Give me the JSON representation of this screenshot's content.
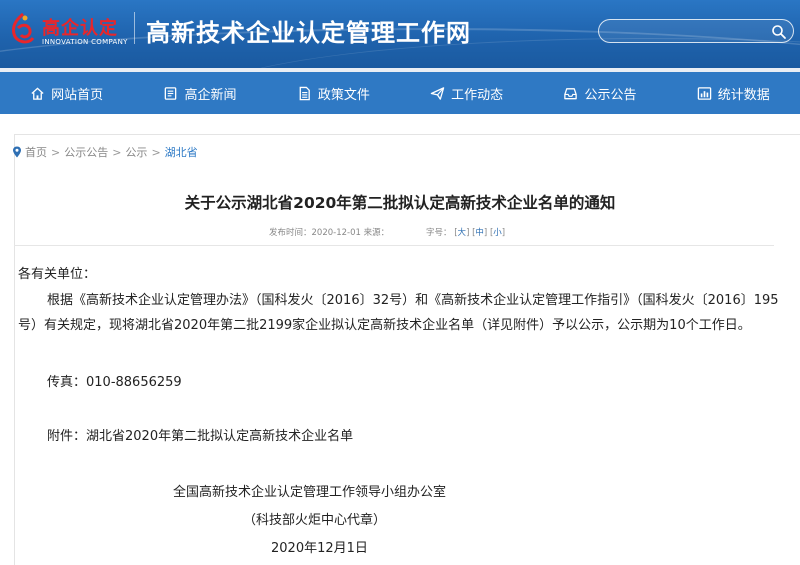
{
  "header": {
    "logo_cn": "高企认定",
    "logo_en": "INNOVATION COMPANY",
    "site_title": "高新技术企业认定管理工作网",
    "search": {
      "value": "",
      "placeholder": ""
    },
    "colors": {
      "header_blue": "#1f63ad",
      "nav_blue": "#2f79c4",
      "logo_red": "#e8262b"
    }
  },
  "nav": {
    "items": [
      {
        "label": "网站首页",
        "icon": "home-icon"
      },
      {
        "label": "高企新闻",
        "icon": "news-icon"
      },
      {
        "label": "政策文件",
        "icon": "document-icon"
      },
      {
        "label": "工作动态",
        "icon": "paper-plane-icon"
      },
      {
        "label": "公示公告",
        "icon": "inbox-icon"
      },
      {
        "label": "统计数据",
        "icon": "stats-icon"
      }
    ]
  },
  "breadcrumb": {
    "icon": "location-pin-icon",
    "items": [
      "首页",
      "公示公告",
      "公示"
    ],
    "separator": ">",
    "current": "湖北省"
  },
  "article": {
    "title": "关于公示湖北省2020年第二批拟认定高新技术企业名单的通知",
    "meta": {
      "publish_label": "发布时间：",
      "publish_date": "2020-12-01",
      "source_label": "来源：",
      "font_label": "字号：",
      "font_large": "大",
      "font_medium": "中",
      "font_small": "小"
    },
    "salutation": "各有关单位：",
    "paragraph": "根据《高新技术企业认定管理办法》（国科发火〔2016〕32号）和《高新技术企业认定管理工作指引》（国科发火〔2016〕195号）有关规定，现将湖北省2020年第二批2199家企业拟认定高新技术企业名单（详见附件）予以公示，公示期为10个工作日。",
    "fax": "传真：010-88656259",
    "attachment": "附件：湖北省2020年第二批拟认定高新技术企业名单",
    "signature_org": "全国高新技术企业认定管理工作领导小组办公室",
    "signature_note": "（科技部火炬中心代章）",
    "signature_date": "2020年12月1日"
  }
}
